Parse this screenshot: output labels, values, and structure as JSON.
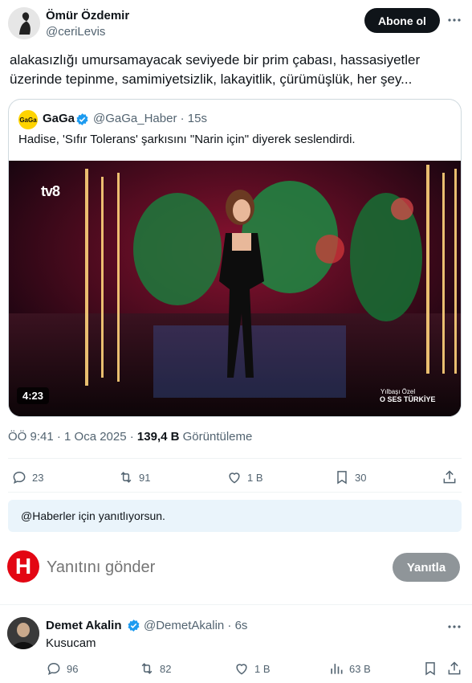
{
  "author": {
    "name": "Ömür Özdemir",
    "handle": "@ceriLevis",
    "follow_label": "Abone ol"
  },
  "tweet": {
    "text": "alakasızlığı umursamayacak seviyede bir prim çabası, hassasiyetler üzerinde tepinme, samimiyetsizlik, lakayitlik, çürümüşlük, her şey..."
  },
  "quote": {
    "logo_text": "GaGa",
    "name": "GaGa",
    "handle_time": "@GaGa_Haber · 15s",
    "text": "Hadise, 'Sıfır Tolerans' şarkısını \"Narin için\" diyerek seslendirdi.",
    "video": {
      "duration": "4:23",
      "channel": "tv8",
      "overlay_sub": "Yılbaşı Özel",
      "overlay_title": "O SES TÜRKİYE"
    }
  },
  "meta": {
    "time": "ÖÖ 9:41 · 1 Oca 2025 · ",
    "views_count": "139,4 B",
    "views_label": " Görüntüleme"
  },
  "actions": {
    "replies": "23",
    "reposts": "91",
    "likes": "1 B",
    "bookmarks": "30"
  },
  "reply_banner": {
    "text": "@Haberler için yanıtlıyorsun."
  },
  "composer": {
    "avatar_letter": "H",
    "placeholder": "Yanıtını gönder",
    "button_label": "Yanıtla"
  },
  "reply_tweet": {
    "name": "Demet Akalin",
    "handle_time": "@DemetAkalin · 6s",
    "text": "Kusucam",
    "replies": "96",
    "reposts": "82",
    "likes": "1 B",
    "views": "63 B"
  },
  "colors": {
    "text": "#0f1419",
    "muted": "#536471",
    "verified": "#1d9bf0",
    "banner": "#eaf4fb",
    "disabled_button": "#8f9599"
  }
}
